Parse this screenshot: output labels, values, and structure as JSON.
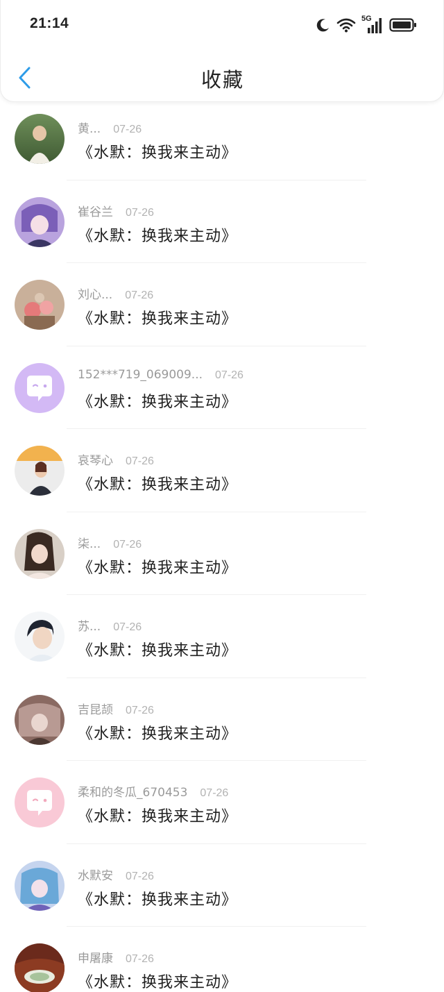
{
  "status_bar": {
    "time": "21:14",
    "network": "5G",
    "icons": [
      "moon-icon",
      "wifi-icon",
      "signal-5g-icon",
      "battery-icon"
    ]
  },
  "nav": {
    "title": "收藏",
    "back_icon": "chevron-left-icon"
  },
  "colors": {
    "accent": "#2e9ce8",
    "placeholder_purple": "#d3b9f5",
    "placeholder_pink": "#f9c9d6"
  },
  "favorites": [
    {
      "user": "黄...",
      "date": "07-26",
      "title": "《水默：换我来主动》",
      "avatar": "photo-avatar"
    },
    {
      "user": "崔谷兰",
      "date": "07-26",
      "title": "《水默：换我来主动》",
      "avatar": "anime-avatar"
    },
    {
      "user": "刘心...",
      "date": "07-26",
      "title": "《水默：换我来主动》",
      "avatar": "flowers-avatar"
    },
    {
      "user": "152***719_069009...",
      "date": "07-26",
      "title": "《水默：换我来主动》",
      "avatar": "default-chat-avatar-purple"
    },
    {
      "user": "哀琴心",
      "date": "07-26",
      "title": "《水默：换我来主动》",
      "avatar": "photo-avatar"
    },
    {
      "user": "柒...",
      "date": "07-26",
      "title": "《水默：换我来主动》",
      "avatar": "photo-avatar"
    },
    {
      "user": "苏...",
      "date": "07-26",
      "title": "《水默：换我来主动》",
      "avatar": "photo-avatar"
    },
    {
      "user": "吉昆颉",
      "date": "07-26",
      "title": "《水默：换我来主动》",
      "avatar": "anime-avatar"
    },
    {
      "user": "柔和的冬瓜_670453",
      "date": "07-26",
      "title": "《水默：换我来主动》",
      "avatar": "default-chat-avatar-pink"
    },
    {
      "user": "水默安",
      "date": "07-26",
      "title": "《水默：换我来主动》",
      "avatar": "anime-avatar"
    },
    {
      "user": "申屠康",
      "date": "07-26",
      "title": "《水默：换我来主动》",
      "avatar": "photo-avatar"
    }
  ]
}
